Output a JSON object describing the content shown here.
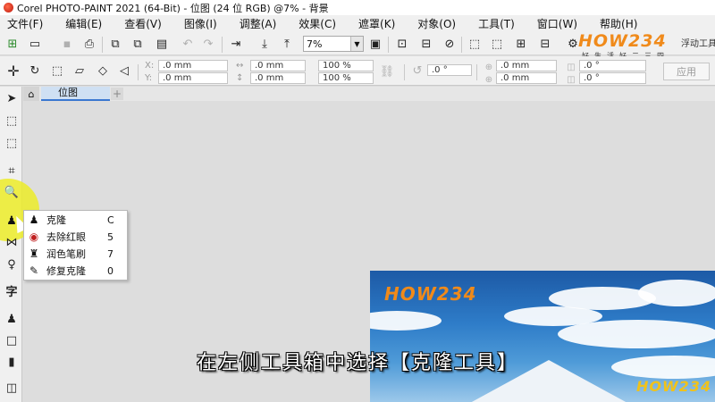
{
  "window": {
    "title": "Corel PHOTO-PAINT 2021 (64-Bit) - 位图 (24 位 RGB) @7% - 背景"
  },
  "menu": [
    "文件(F)",
    "编辑(E)",
    "查看(V)",
    "图像(I)",
    "调整(A)",
    "效果(C)",
    "遮罩(K)",
    "对象(O)",
    "工具(T)",
    "窗口(W)",
    "帮助(H)"
  ],
  "toolbar": {
    "zoom_value": "7%",
    "x_label": "X:",
    "y_label": "Y:",
    "x_value": ".0 mm",
    "y_value": ".0 mm",
    "w_value": ".0 mm",
    "h_value": ".0 mm",
    "scale_w": "100 %",
    "scale_h": "100 %",
    "angle_value": ".0 °",
    "x2_value": ".0 mm",
    "y2_value": ".0 mm",
    "angle2_value": ".0 °",
    "angle3_value": ".0 °",
    "apply_label": "应用"
  },
  "tabs": {
    "document_tab": "位图"
  },
  "toolbox": {
    "text_tool": "字"
  },
  "flyout": {
    "items": [
      {
        "label": "克隆",
        "shortcut": "C"
      },
      {
        "label": "去除红眼",
        "shortcut": "5"
      },
      {
        "label": "润色笔刷",
        "shortcut": "7"
      },
      {
        "label": "修复克隆",
        "shortcut": "0"
      }
    ]
  },
  "watermark": {
    "logo_text": "HOW234",
    "logo_sub": "好生活好二三四",
    "partial_tb_text": "浮动工具栏"
  },
  "subtitle": "在左侧工具箱中选择【克隆工具】",
  "colors": {
    "accent_tab": "#3a78d0",
    "highlight": "#ecec28",
    "sky": "#2e7cc8"
  }
}
